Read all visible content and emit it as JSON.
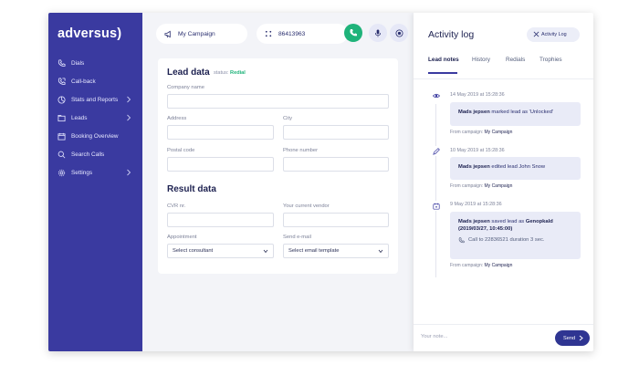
{
  "sidebar": {
    "logo": "adversus)",
    "items": [
      {
        "label": "Dials",
        "icon": "phone-icon",
        "submenu": false
      },
      {
        "label": "Call-back",
        "icon": "callback-icon",
        "submenu": false
      },
      {
        "label": "Stats and Reports",
        "icon": "chart-icon",
        "submenu": true
      },
      {
        "label": "Leads",
        "icon": "folder-icon",
        "submenu": true
      },
      {
        "label": "Booking Overview",
        "icon": "calendar-icon",
        "submenu": false
      },
      {
        "label": "Search Calls",
        "icon": "search-icon",
        "submenu": false
      },
      {
        "label": "Settings",
        "icon": "gear-icon",
        "submenu": true
      }
    ]
  },
  "topbar": {
    "campaign": "My Campaign",
    "phone_number": "86413963"
  },
  "lead": {
    "title": "Lead data",
    "status_label": "status:",
    "status_value": "Redial",
    "fields": {
      "company_name": "Company name",
      "address": "Address",
      "city": "City",
      "postal_code": "Postal code",
      "phone_number": "Phone number"
    }
  },
  "result": {
    "title": "Result data",
    "fields": {
      "cvr": "CVR nr.",
      "vendor": "Your current vendor",
      "appointment": "Appointment",
      "send_email": "Send e-mail"
    },
    "appointment_select": "Select consultant",
    "email_select": "Select email template"
  },
  "activity": {
    "title": "Activity log",
    "button_label": "Activity Log",
    "tabs": [
      "Lead notes",
      "History",
      "Redials",
      "Trophies"
    ],
    "entries": [
      {
        "icon": "eye-icon",
        "time": "14 May 2019 at 15:28:36",
        "user": "Mads jepsen",
        "text": "marked lead as 'Unlocked'",
        "from_label": "From campaign:",
        "from_campaign": "My Campaign"
      },
      {
        "icon": "pencil-icon",
        "time": "10 May 2019 at 15:28:36",
        "user": "Mads jepsen",
        "text": "edited lead John Snow",
        "from_label": "From campaign:",
        "from_campaign": "My Campaign"
      },
      {
        "icon": "calendar-icon",
        "time": "9 May 2019 at 15:28:36",
        "user": "Mads jepsen",
        "text": "saved lead as",
        "highlight": "Genopkald (2019/03/27, 10:45:00)",
        "call": "Call to 22836521 duration 3 sec.",
        "from_label": "From campaign:",
        "from_campaign": "My Campaign"
      }
    ],
    "note_placeholder": "Your note...",
    "send_label": "Send"
  }
}
